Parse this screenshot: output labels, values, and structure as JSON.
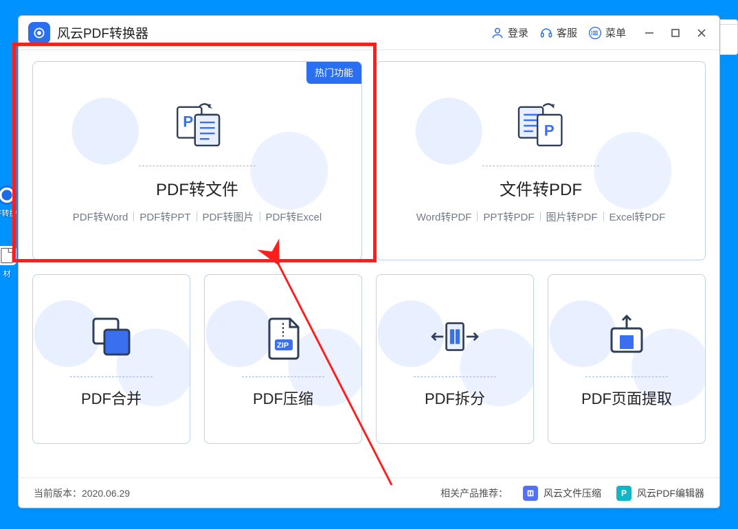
{
  "app": {
    "title": "风云PDF转换器"
  },
  "titlebar": {
    "login_label": "登录",
    "support_label": "客服",
    "menu_label": "菜单"
  },
  "cards": {
    "pdf_to_file": {
      "title": "PDF转文件",
      "hot_tag": "热门功能",
      "subs": [
        "PDF转Word",
        "PDF转PPT",
        "PDF转图片",
        "PDF转Excel"
      ]
    },
    "file_to_pdf": {
      "title": "文件转PDF",
      "subs": [
        "Word转PDF",
        "PPT转PDF",
        "图片转PDF",
        "Excel转PDF"
      ]
    },
    "merge": {
      "title": "PDF合并"
    },
    "compress": {
      "title": "PDF压缩"
    },
    "split": {
      "title": "PDF拆分"
    },
    "extract": {
      "title": "PDF页面提取"
    }
  },
  "footer": {
    "version_label": "当前版本：",
    "version_value": "2020.06.29",
    "related_label": "相关产品推荐：",
    "product1": "风云文件压缩",
    "product2": "风云PDF编辑器"
  },
  "desktop": {
    "icon1_label": "F转护",
    "icon2_label": "材"
  }
}
